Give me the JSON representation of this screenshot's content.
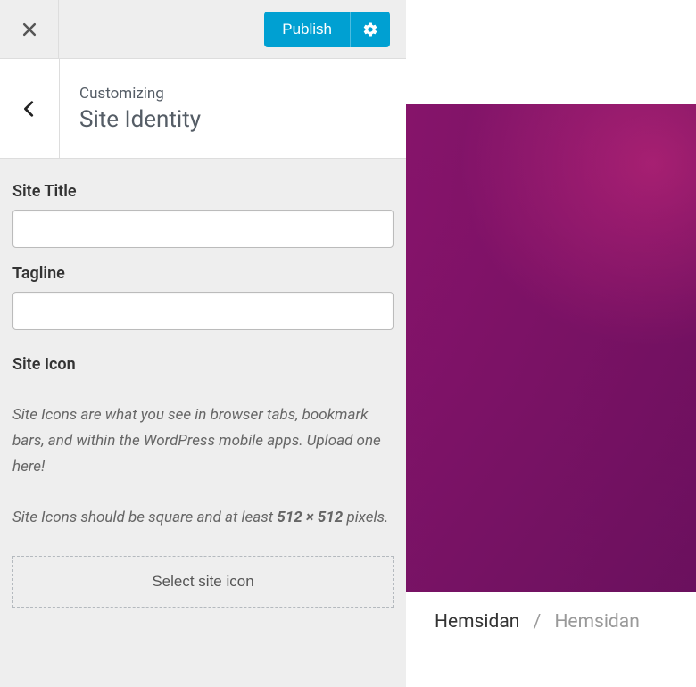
{
  "topbar": {
    "publish_label": "Publish"
  },
  "header": {
    "supertitle": "Customizing",
    "title": "Site Identity"
  },
  "fields": {
    "site_title_label": "Site Title",
    "site_title_value": "",
    "tagline_label": "Tagline",
    "tagline_value": ""
  },
  "site_icon": {
    "label": "Site Icon",
    "desc1": "Site Icons are what you see in browser tabs, bookmark bars, and within the WordPress mobile apps. Upload one here!",
    "desc2_prefix": "Site Icons should be square and at least ",
    "desc2_strong": "512 × 512",
    "desc2_suffix": " pixels.",
    "select_button": "Select site icon"
  },
  "preview": {
    "breadcrumb_home": "Hemsidan",
    "breadcrumb_current": "Hemsidan"
  }
}
